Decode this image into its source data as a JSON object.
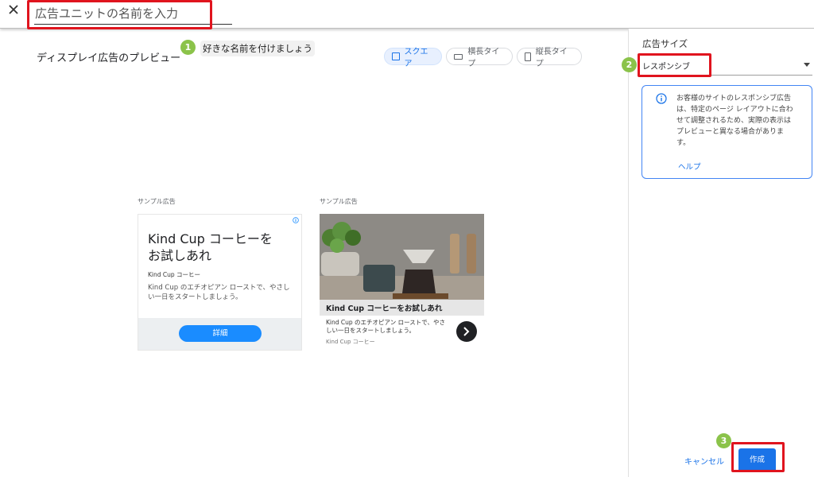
{
  "header": {
    "name_placeholder": "広告ユニットの名前を入力"
  },
  "steps": {
    "one": "1",
    "two": "2",
    "three": "3",
    "hint_name": "好きな名前を付けましょう"
  },
  "preview": {
    "title": "ディスプレイ広告のプレビュー",
    "toggles": [
      "スクエア",
      "横長タイプ",
      "縦長タイプ"
    ],
    "sample_label": "サンプル広告",
    "ad1": {
      "headline": "Kind Cup コーヒーを お試しあれ",
      "brand": "Kind Cup コーヒー",
      "body": "Kind Cup のエチオピアン ローストで、やさしい一日をスタートしましょう。",
      "button": "詳細"
    },
    "ad2": {
      "headline": "Kind Cup コーヒーをお試しあれ",
      "body": "Kind Cup のエチオピアン ローストで、やさしい一日をスタートしましょう。",
      "brand": "Kind Cup コーヒー"
    }
  },
  "sidebar": {
    "size_label": "広告サイズ",
    "size_value": "レスポンシブ",
    "info_text": "お客様のサイトのレスポンシブ広告は、特定のページ レイアウトに合わせて調整されるため、実際の表示はプレビューと異なる場合があります。",
    "help_link": "ヘルプ",
    "cancel": "キャンセル",
    "create": "作成"
  },
  "colors": {
    "accent": "#1a73e8",
    "highlight_red": "#e0141e",
    "badge_green": "#8bc34a"
  }
}
